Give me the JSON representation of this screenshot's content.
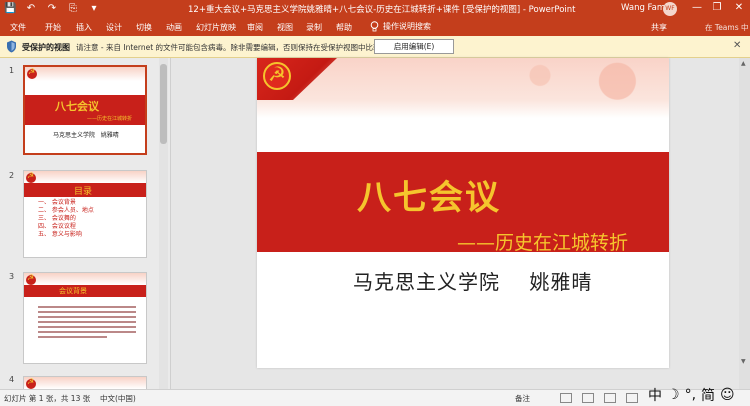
{
  "titlebar": {
    "quick_access": [
      "💾",
      "↶",
      "↷",
      "⎘",
      "▾"
    ],
    "doc_title": "12+重大会议+马克思主义学院姚雅晴+八七会议-历史在江城转折+课件 [受保护的视图] - PowerPoint",
    "user": "Wang Famin",
    "avatar": "WF",
    "min": "—",
    "max": "❐",
    "close": "✕"
  },
  "ribbon": {
    "tabs": [
      "文件",
      "开始",
      "插入",
      "设计",
      "切换",
      "动画",
      "幻灯片放映",
      "审阅",
      "视图",
      "录制",
      "帮助"
    ],
    "search_icon": "lightbulb-icon",
    "search_label": "操作说明搜索",
    "share": "共享",
    "teams": "在 Teams 中"
  },
  "protected_view": {
    "title": "受保护的视图",
    "message": "请注意 - 来自 Internet 的文件可能包含病毒。除非需要编辑，否则保持在受保护视图中比较安全。",
    "enable_button": "启用编辑(E)",
    "close": "✕"
  },
  "thumbnails": [
    {
      "number": "1",
      "title": "八七会议",
      "subtitle": "——历史在江城转折",
      "author": "马克思主义学院   姚雅晴"
    },
    {
      "number": "2",
      "title": "目录",
      "items": [
        "一、 会议背景",
        "二、 参会人员、地点",
        "三、 会议舞的",
        "四、 会议议程",
        "五、 意义与影响"
      ]
    },
    {
      "number": "3",
      "title": "会议背景"
    },
    {
      "number": "4"
    }
  ],
  "slide": {
    "title": "八七会议",
    "subtitle": "——历史在江城转折",
    "author": "马克思主义学院    姚雅晴"
  },
  "statusbar": {
    "slide_info": "幻灯片 第 1 张，共 13 张",
    "language": "中文(中国)",
    "notes": "备注"
  },
  "ime": {
    "mode": "中",
    "moon": "☽",
    "punct": "°,",
    "simp": "简",
    "emoji": "☺"
  },
  "colors": {
    "accent": "#c43e1c",
    "slide_red": "#c8201a",
    "slide_gold": "#f5c52d",
    "warning_bg": "#fdf3cf"
  }
}
